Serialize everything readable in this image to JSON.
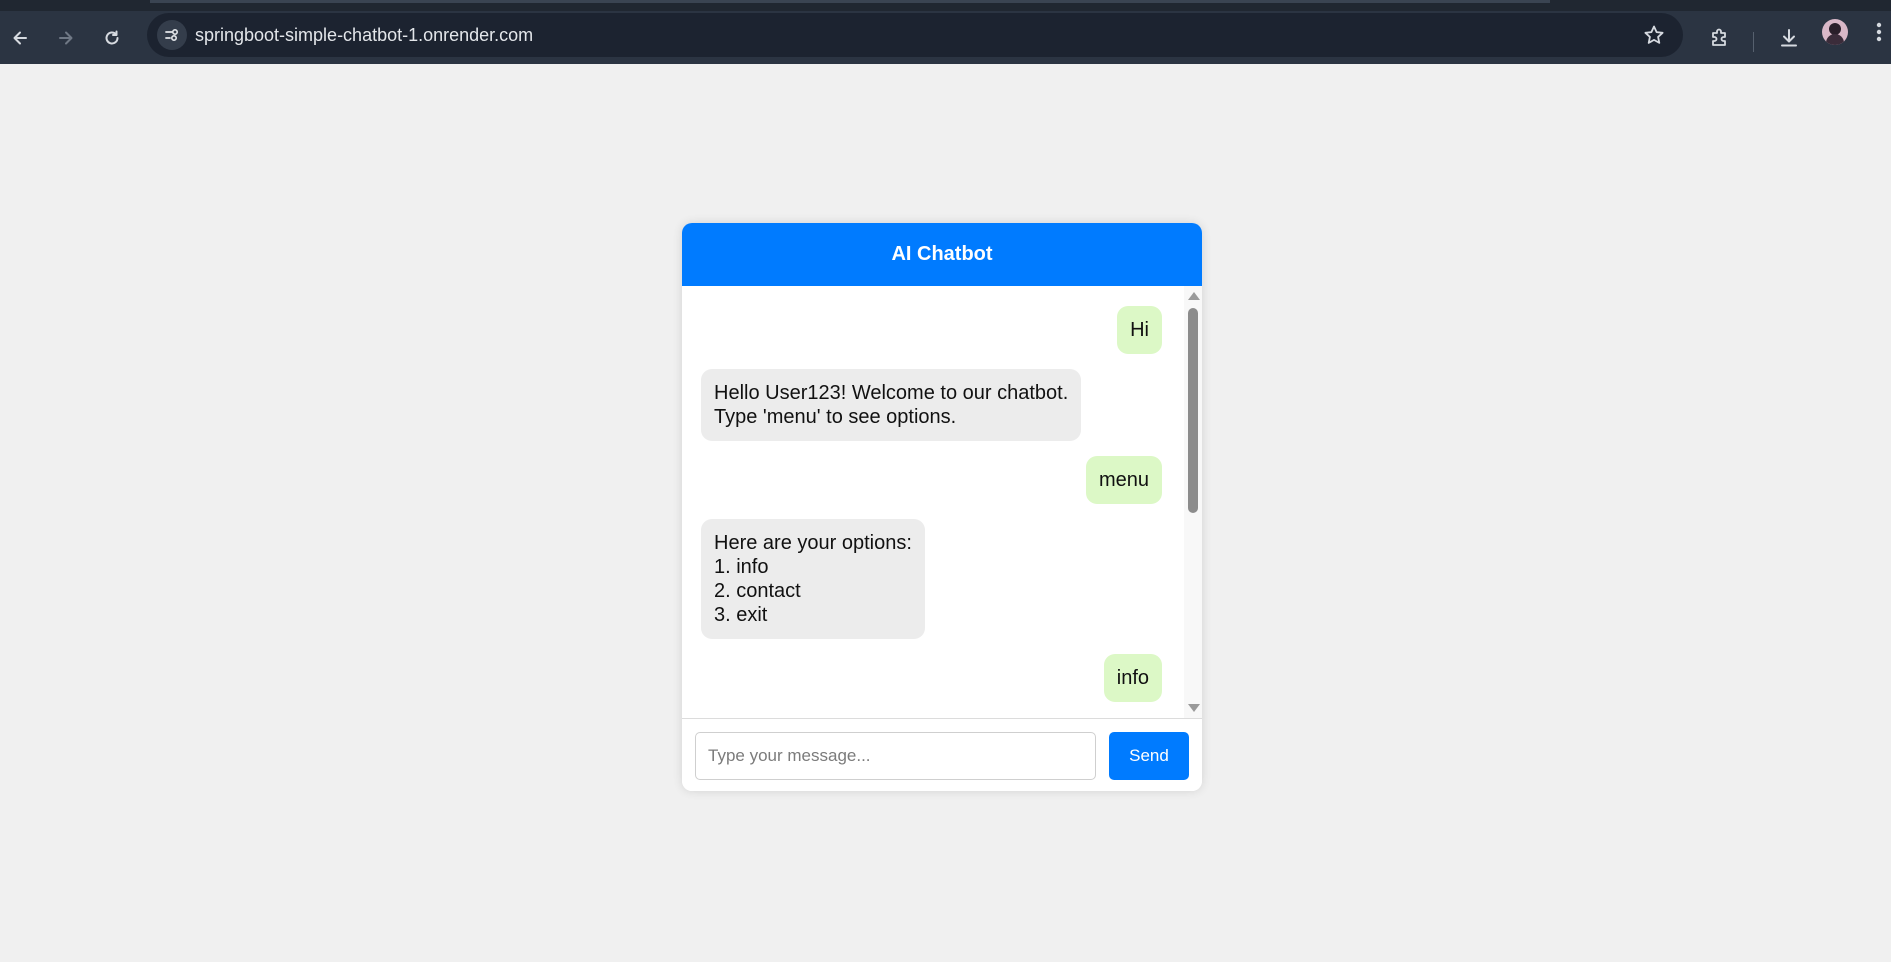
{
  "browser": {
    "url": "springboot-simple-chatbot-1.onrender.com",
    "icons": {
      "back": "arrow-left-icon",
      "forward": "arrow-right-icon",
      "reload": "reload-icon",
      "site_info": "tune-icon",
      "bookmark": "star-icon",
      "extensions": "puzzle-icon",
      "downloads": "download-icon",
      "profile": "avatar",
      "menu": "kebab-menu-icon"
    }
  },
  "chat": {
    "title": "AI Chatbot",
    "messages": [
      {
        "sender": "user",
        "text": "Hi"
      },
      {
        "sender": "bot",
        "text": "Hello User123! Welcome to our chatbot.\nType 'menu' to see options."
      },
      {
        "sender": "user",
        "text": "menu"
      },
      {
        "sender": "bot",
        "text": "Here are your options:\n1. info\n2. contact\n3. exit"
      },
      {
        "sender": "user",
        "text": "info"
      }
    ],
    "input_placeholder": "Type your message...",
    "send_label": "Send"
  },
  "colors": {
    "accent": "#007bff",
    "user_bubble": "#dcf8c6",
    "bot_bubble": "#ececec",
    "page_background": "#f0f0f0",
    "browser_toolbar": "#2b3442"
  }
}
